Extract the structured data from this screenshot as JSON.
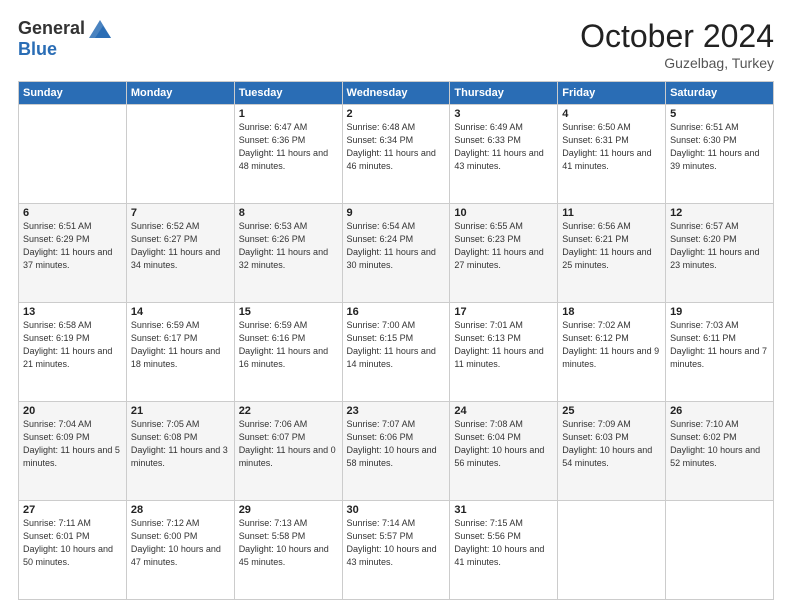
{
  "logo": {
    "general": "General",
    "blue": "Blue"
  },
  "header": {
    "month": "October 2024",
    "location": "Guzelbag, Turkey"
  },
  "days_of_week": [
    "Sunday",
    "Monday",
    "Tuesday",
    "Wednesday",
    "Thursday",
    "Friday",
    "Saturday"
  ],
  "weeks": [
    [
      {
        "day": "",
        "info": ""
      },
      {
        "day": "",
        "info": ""
      },
      {
        "day": "1",
        "info": "Sunrise: 6:47 AM\nSunset: 6:36 PM\nDaylight: 11 hours and 48 minutes."
      },
      {
        "day": "2",
        "info": "Sunrise: 6:48 AM\nSunset: 6:34 PM\nDaylight: 11 hours and 46 minutes."
      },
      {
        "day": "3",
        "info": "Sunrise: 6:49 AM\nSunset: 6:33 PM\nDaylight: 11 hours and 43 minutes."
      },
      {
        "day": "4",
        "info": "Sunrise: 6:50 AM\nSunset: 6:31 PM\nDaylight: 11 hours and 41 minutes."
      },
      {
        "day": "5",
        "info": "Sunrise: 6:51 AM\nSunset: 6:30 PM\nDaylight: 11 hours and 39 minutes."
      }
    ],
    [
      {
        "day": "6",
        "info": "Sunrise: 6:51 AM\nSunset: 6:29 PM\nDaylight: 11 hours and 37 minutes."
      },
      {
        "day": "7",
        "info": "Sunrise: 6:52 AM\nSunset: 6:27 PM\nDaylight: 11 hours and 34 minutes."
      },
      {
        "day": "8",
        "info": "Sunrise: 6:53 AM\nSunset: 6:26 PM\nDaylight: 11 hours and 32 minutes."
      },
      {
        "day": "9",
        "info": "Sunrise: 6:54 AM\nSunset: 6:24 PM\nDaylight: 11 hours and 30 minutes."
      },
      {
        "day": "10",
        "info": "Sunrise: 6:55 AM\nSunset: 6:23 PM\nDaylight: 11 hours and 27 minutes."
      },
      {
        "day": "11",
        "info": "Sunrise: 6:56 AM\nSunset: 6:21 PM\nDaylight: 11 hours and 25 minutes."
      },
      {
        "day": "12",
        "info": "Sunrise: 6:57 AM\nSunset: 6:20 PM\nDaylight: 11 hours and 23 minutes."
      }
    ],
    [
      {
        "day": "13",
        "info": "Sunrise: 6:58 AM\nSunset: 6:19 PM\nDaylight: 11 hours and 21 minutes."
      },
      {
        "day": "14",
        "info": "Sunrise: 6:59 AM\nSunset: 6:17 PM\nDaylight: 11 hours and 18 minutes."
      },
      {
        "day": "15",
        "info": "Sunrise: 6:59 AM\nSunset: 6:16 PM\nDaylight: 11 hours and 16 minutes."
      },
      {
        "day": "16",
        "info": "Sunrise: 7:00 AM\nSunset: 6:15 PM\nDaylight: 11 hours and 14 minutes."
      },
      {
        "day": "17",
        "info": "Sunrise: 7:01 AM\nSunset: 6:13 PM\nDaylight: 11 hours and 11 minutes."
      },
      {
        "day": "18",
        "info": "Sunrise: 7:02 AM\nSunset: 6:12 PM\nDaylight: 11 hours and 9 minutes."
      },
      {
        "day": "19",
        "info": "Sunrise: 7:03 AM\nSunset: 6:11 PM\nDaylight: 11 hours and 7 minutes."
      }
    ],
    [
      {
        "day": "20",
        "info": "Sunrise: 7:04 AM\nSunset: 6:09 PM\nDaylight: 11 hours and 5 minutes."
      },
      {
        "day": "21",
        "info": "Sunrise: 7:05 AM\nSunset: 6:08 PM\nDaylight: 11 hours and 3 minutes."
      },
      {
        "day": "22",
        "info": "Sunrise: 7:06 AM\nSunset: 6:07 PM\nDaylight: 11 hours and 0 minutes."
      },
      {
        "day": "23",
        "info": "Sunrise: 7:07 AM\nSunset: 6:06 PM\nDaylight: 10 hours and 58 minutes."
      },
      {
        "day": "24",
        "info": "Sunrise: 7:08 AM\nSunset: 6:04 PM\nDaylight: 10 hours and 56 minutes."
      },
      {
        "day": "25",
        "info": "Sunrise: 7:09 AM\nSunset: 6:03 PM\nDaylight: 10 hours and 54 minutes."
      },
      {
        "day": "26",
        "info": "Sunrise: 7:10 AM\nSunset: 6:02 PM\nDaylight: 10 hours and 52 minutes."
      }
    ],
    [
      {
        "day": "27",
        "info": "Sunrise: 7:11 AM\nSunset: 6:01 PM\nDaylight: 10 hours and 50 minutes."
      },
      {
        "day": "28",
        "info": "Sunrise: 7:12 AM\nSunset: 6:00 PM\nDaylight: 10 hours and 47 minutes."
      },
      {
        "day": "29",
        "info": "Sunrise: 7:13 AM\nSunset: 5:58 PM\nDaylight: 10 hours and 45 minutes."
      },
      {
        "day": "30",
        "info": "Sunrise: 7:14 AM\nSunset: 5:57 PM\nDaylight: 10 hours and 43 minutes."
      },
      {
        "day": "31",
        "info": "Sunrise: 7:15 AM\nSunset: 5:56 PM\nDaylight: 10 hours and 41 minutes."
      },
      {
        "day": "",
        "info": ""
      },
      {
        "day": "",
        "info": ""
      }
    ]
  ]
}
